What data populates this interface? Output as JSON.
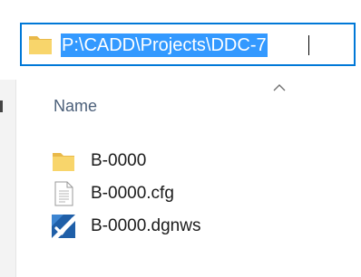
{
  "address_bar": {
    "path": "P:\\CADD\\Projects\\DDC-7",
    "icon": "folder-icon"
  },
  "column_header": {
    "name_label": "Name",
    "sort_icon": "sort-ascending-icon"
  },
  "files": [
    {
      "name": "B-0000",
      "icon": "folder-icon"
    },
    {
      "name": "B-0000.cfg",
      "icon": "text-file-icon"
    },
    {
      "name": "B-0000.dgnws",
      "icon": "microstation-workspace-icon"
    }
  ],
  "colors": {
    "accent": "#0078d7",
    "selection": "#3399ff",
    "folder": "#f8d56b"
  }
}
